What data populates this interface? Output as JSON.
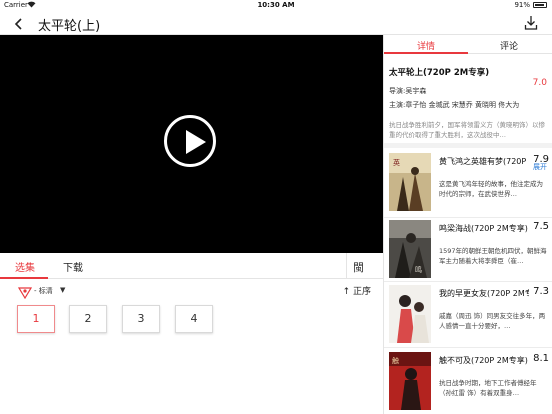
{
  "status_bar": {
    "carrier": "Carrier",
    "wifi_icon": "wifi-icon",
    "time": "10:30 AM",
    "battery_pct": "91%"
  },
  "navbar": {
    "title": "太平轮(上)",
    "back_icon": "back-chevron-icon",
    "download_icon": "download-icon"
  },
  "player": {
    "play_icon": "play-icon"
  },
  "episode_tabs": {
    "tabs": [
      "选集",
      "下载"
    ],
    "active_tab": 0,
    "list_icon_glyph": "閩"
  },
  "quality": {
    "label": "- 标清",
    "caret": "▼",
    "order_label": "↑ 正序"
  },
  "episodes": [
    "1",
    "2",
    "3",
    "4"
  ],
  "active_episode": 0,
  "right_panel": {
    "tabs": [
      "详情",
      "评论"
    ],
    "active_tab": 0,
    "detail": {
      "title": "太平轮上(720P 2M专享)",
      "score": "7.0",
      "director": "导演:吴宇森",
      "cast": "主演:章子怡 金城武 宋慧乔 黄晓明 佟大为",
      "description": "抗日战争胜利前夕，国军将领雷义方（黄晓明饰）以惨重的代价取得了重大胜利，这次战役中…",
      "more": "展开"
    },
    "recommendations": [
      {
        "title": "黄飞鸿之英雄有梦(720P",
        "score": "7.9",
        "description": "这是黄飞鸿年轻的故事，他注定成为时代的宗师，在武侠世界…"
      },
      {
        "title": "鸣梁海战(720P 2M专享)",
        "score": "7.5",
        "description": "1597年的朝鲜王朝危机四伏，朝鲜海军主力随着大将李舜臣（崔…"
      },
      {
        "title": "我的早更女友(720P 2M专",
        "score": "7.3",
        "description": "戚嘉（周迅 饰）同男友交往多年，两人感情一直十分要好，…"
      },
      {
        "title": "触不可及(720P 2M专享)",
        "score": "8.1",
        "description": "抗日战争时期，地下工作者傅经年（孙红雷 饰）有着双重身…"
      }
    ]
  }
}
